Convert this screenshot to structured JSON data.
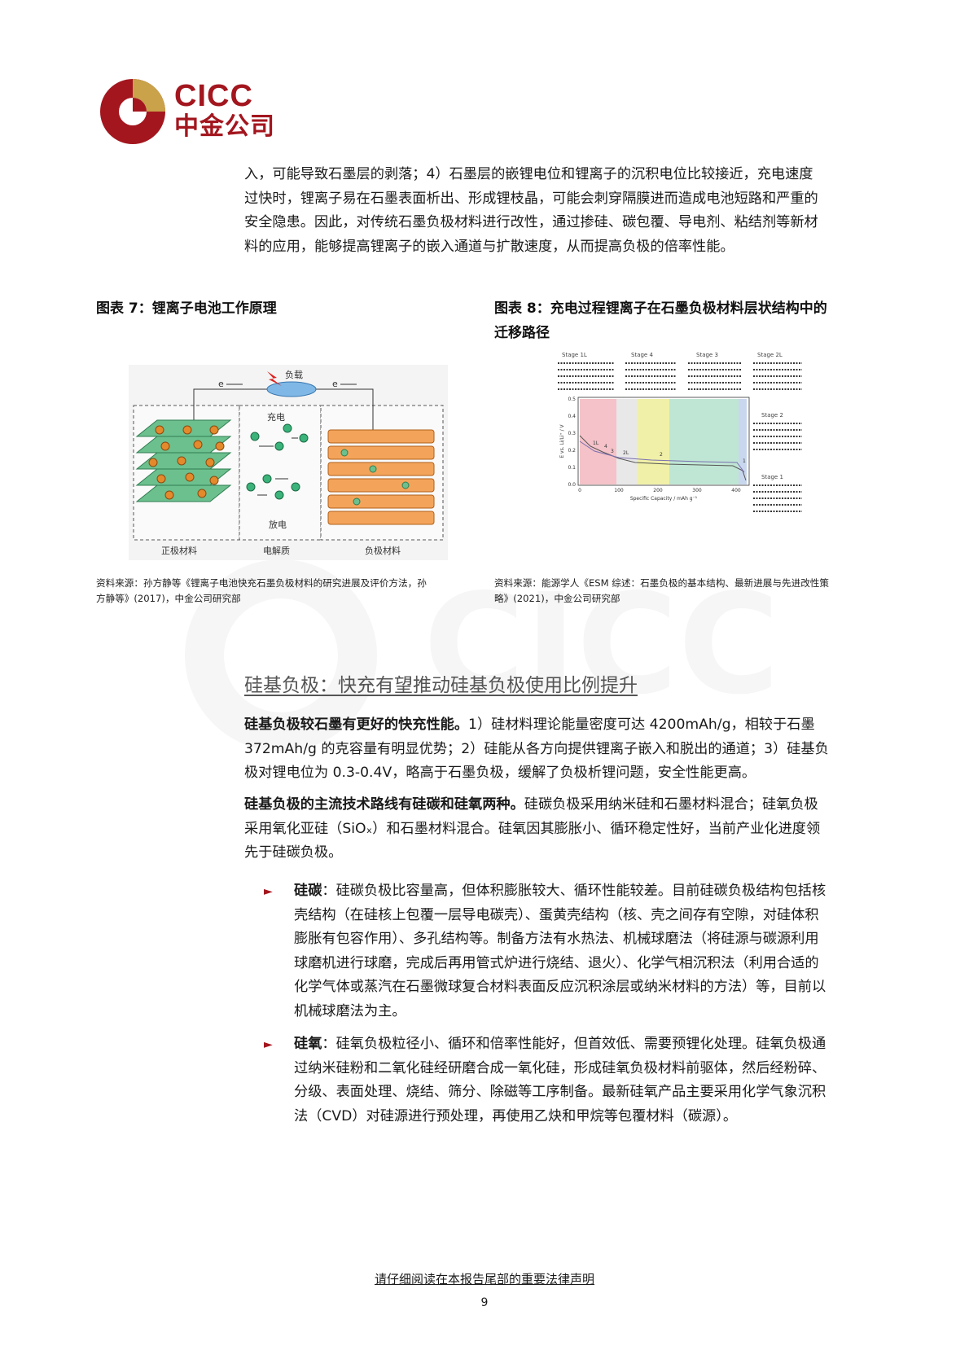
{
  "header": {
    "logo_en": "CICC",
    "logo_cn": "中金公司"
  },
  "intro": {
    "lines": [
      "入，可能导致石墨层的剥落；4）石墨层的嵌锂电位和锂离子的沉积电位比较接近，充电速度",
      "过快时，锂离子易在石墨表面析出、形成锂枝晶，可能会刺穿隔膜进而造成电池短路和严重的",
      "安全隐患。因此，对传统石墨负极材料进行改性，通过掺硅、碳包覆、导电剂、粘结剂等新材",
      "料的应用，能够提高锂离子的嵌入通道与扩散速度，从而提高负极的倍率性能。"
    ]
  },
  "figure7": {
    "title": "图表 7：锂离子电池工作原理",
    "labels": {
      "load": "负载",
      "e_left": "e",
      "e_right": "e",
      "charge": "充电",
      "discharge": "放电",
      "cathode": "正极材料",
      "electrolyte": "电解质",
      "anode": "负极材料",
      "li": "Li"
    },
    "source_lines": [
      "资料来源：孙方静等《锂离子电池快充石墨负极材料的研究进展及评价方法，孙",
      "方静等》(2017)，中金公司研究部"
    ]
  },
  "figure8": {
    "title_lines": [
      "图表 8：充电过程锂离子在石墨负极材料层状结构中的",
      "迁移路径"
    ],
    "stages_top": [
      "Stage 1L",
      "Stage 4",
      "Stage 3",
      "Stage 2L"
    ],
    "stages_right": [
      "Stage 2",
      "Stage 1"
    ],
    "y_label": "E vs. Li/Li⁺ / V",
    "x_label": "Specific Capacity / mAh g⁻¹",
    "y_ticks": [
      "0.5",
      "0.4",
      "0.3",
      "0.2",
      "0.1",
      "0.0"
    ],
    "x_ticks": [
      "0",
      "100",
      "200",
      "300",
      "400"
    ],
    "curve_labels": [
      "1L",
      "4",
      "3",
      "2L",
      "2",
      "1"
    ],
    "source_lines": [
      "资料来源：能源学人《ESM 综述：石墨负极的基本结构、最新进展与先进改性策",
      "略》(2021)，中金公司研究部"
    ]
  },
  "section": {
    "heading": "硅基负极：快充有望推动硅基负极使用比例提升"
  },
  "p1": {
    "bold": "硅基负极较石墨有更好的快充性能。",
    "text_line1": "1）硅材料理论能量密度可达 4200mAh/g，相较于石墨",
    "line2": "372mAh/g 的克容量有明显优势；2）硅能从各方向提供锂离子嵌入和脱出的通道；3）硅基负",
    "line3": "极对锂电位为 0.3-0.4V，略高于石墨负极，缓解了负极析锂问题，安全性能更高。"
  },
  "p2": {
    "bold": "硅基负极的主流技术路线有硅碳和硅氧两种。",
    "text_line1": "硅碳负极采用纳米硅和石墨材料混合；硅氧负极",
    "line2": "采用氧化亚硅（SiOₓ）和石墨材料混合。硅氧因其膨胀小、循环稳定性好，当前产业化进度领",
    "line3": "先于硅碳负极。"
  },
  "bullet1": {
    "marker": "►",
    "bold": "硅碳",
    "lines": [
      "：硅碳负极比容量高，但体积膨胀较大、循环性能较差。目前硅碳负极结构包括核",
      "壳结构（在硅核上包覆一层导电碳壳）、蛋黄壳结构（核、壳之间存有空隙，对硅体积",
      "膨胀有包容作用）、多孔结构等。制备方法有水热法、机械球磨法（将硅源与碳源利用",
      "球磨机进行球磨，完成后再用管式炉进行烧结、退火）、化学气相沉积法（利用合适的",
      "化学气体或蒸汽在石墨微球复合材料表面反应沉积涂层或纳米材料的方法）等，目前以",
      "机械球磨法为主。"
    ]
  },
  "bullet2": {
    "marker": "►",
    "bold": "硅氧",
    "lines": [
      "：硅氧负极粒径小、循环和倍率性能好，但首效低、需要预锂化处理。硅氧负极通",
      "过纳米硅粉和二氧化硅经研磨合成一氧化硅，形成硅氧负极材料前驱体，然后经粉碎、",
      "分级、表面处理、烧结、筛分、除磁等工序制备。最新硅氧产品主要采用化学气象沉积",
      "法（CVD）对硅源进行预处理，再使用乙炔和甲烷等包覆材料（碳源）。"
    ]
  },
  "footer": {
    "notice": "请仔细阅读在本报告尾部的重要法律声明",
    "page": "9"
  },
  "colors": {
    "brand": "#a3161e",
    "accent_gold": "#c9a24a"
  }
}
